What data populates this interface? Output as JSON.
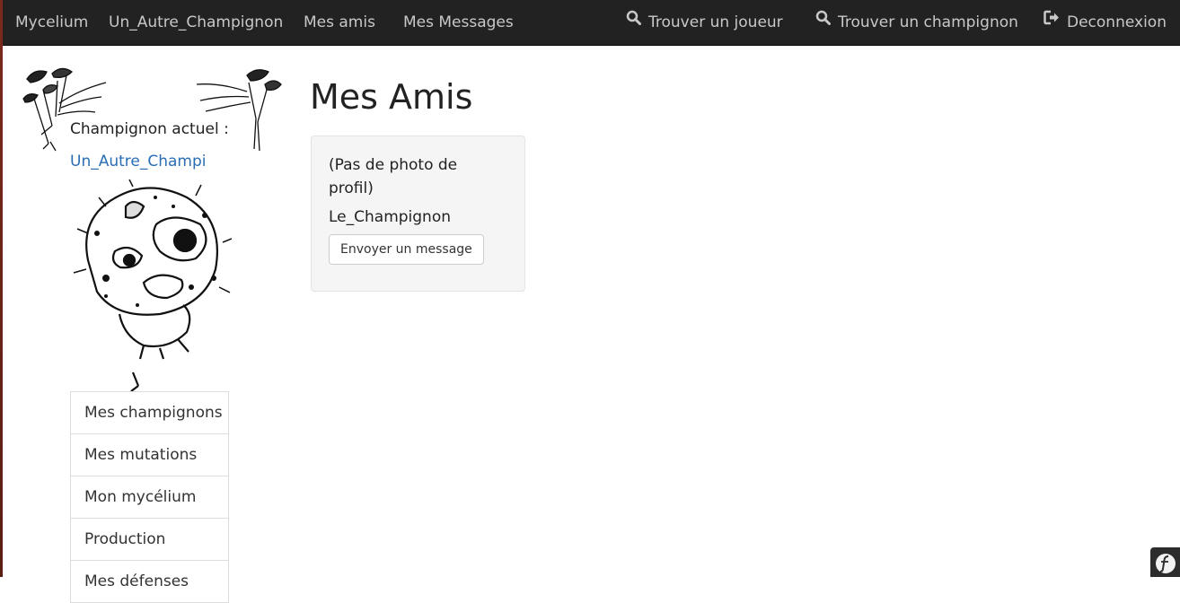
{
  "navbar": {
    "brand": "Mycelium",
    "left_items": [
      "Un_Autre_Champignon",
      "Mes amis",
      "Mes Messages"
    ],
    "find_player": "Trouver un joueur",
    "find_mushroom": "Trouver un champignon",
    "logout": "Deconnexion",
    "search_icon": "search-icon",
    "logout_icon": "sign-out-icon"
  },
  "sidebar": {
    "current_label": "Champignon actuel :",
    "current_name": "Un_Autre_Champi",
    "menu": [
      "Mes champignons",
      "Mes mutations",
      "Mon mycélium",
      "Production",
      "Mes défenses"
    ]
  },
  "main": {
    "title": "Mes Amis",
    "friends": [
      {
        "photo_placeholder": "(Pas de photo de profil)",
        "name": "Le_Champignon",
        "button_label": "Envoyer un message"
      }
    ]
  },
  "colors": {
    "navbar_bg": "#222222",
    "nav_text": "#c8c8c8",
    "link": "#2a6db5",
    "card_bg": "#f5f5f5"
  }
}
